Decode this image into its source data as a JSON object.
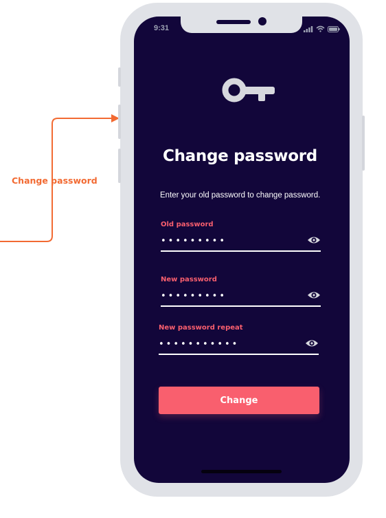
{
  "annotation": {
    "label": "Change password",
    "color": "#f26a32"
  },
  "status_bar": {
    "time": "9:31",
    "icons": [
      "signal-icon",
      "wifi-icon",
      "battery-icon"
    ]
  },
  "header": {
    "icon": "key-icon",
    "title": "Change password",
    "subtitle": "Enter your old password to change password."
  },
  "form": {
    "fields": [
      {
        "label": "Old password",
        "value": "•••••••••",
        "icon": "eye-icon"
      },
      {
        "label": "New password",
        "value": "•••••••••",
        "icon": "eye-icon"
      },
      {
        "label": "New password repeat",
        "value": "•••••••••••",
        "icon": "eye-icon"
      }
    ],
    "submit_label": "Change"
  },
  "colors": {
    "screen_background": "#12063a",
    "accent": "#f95f6e",
    "frame": "#e0e2e7"
  }
}
